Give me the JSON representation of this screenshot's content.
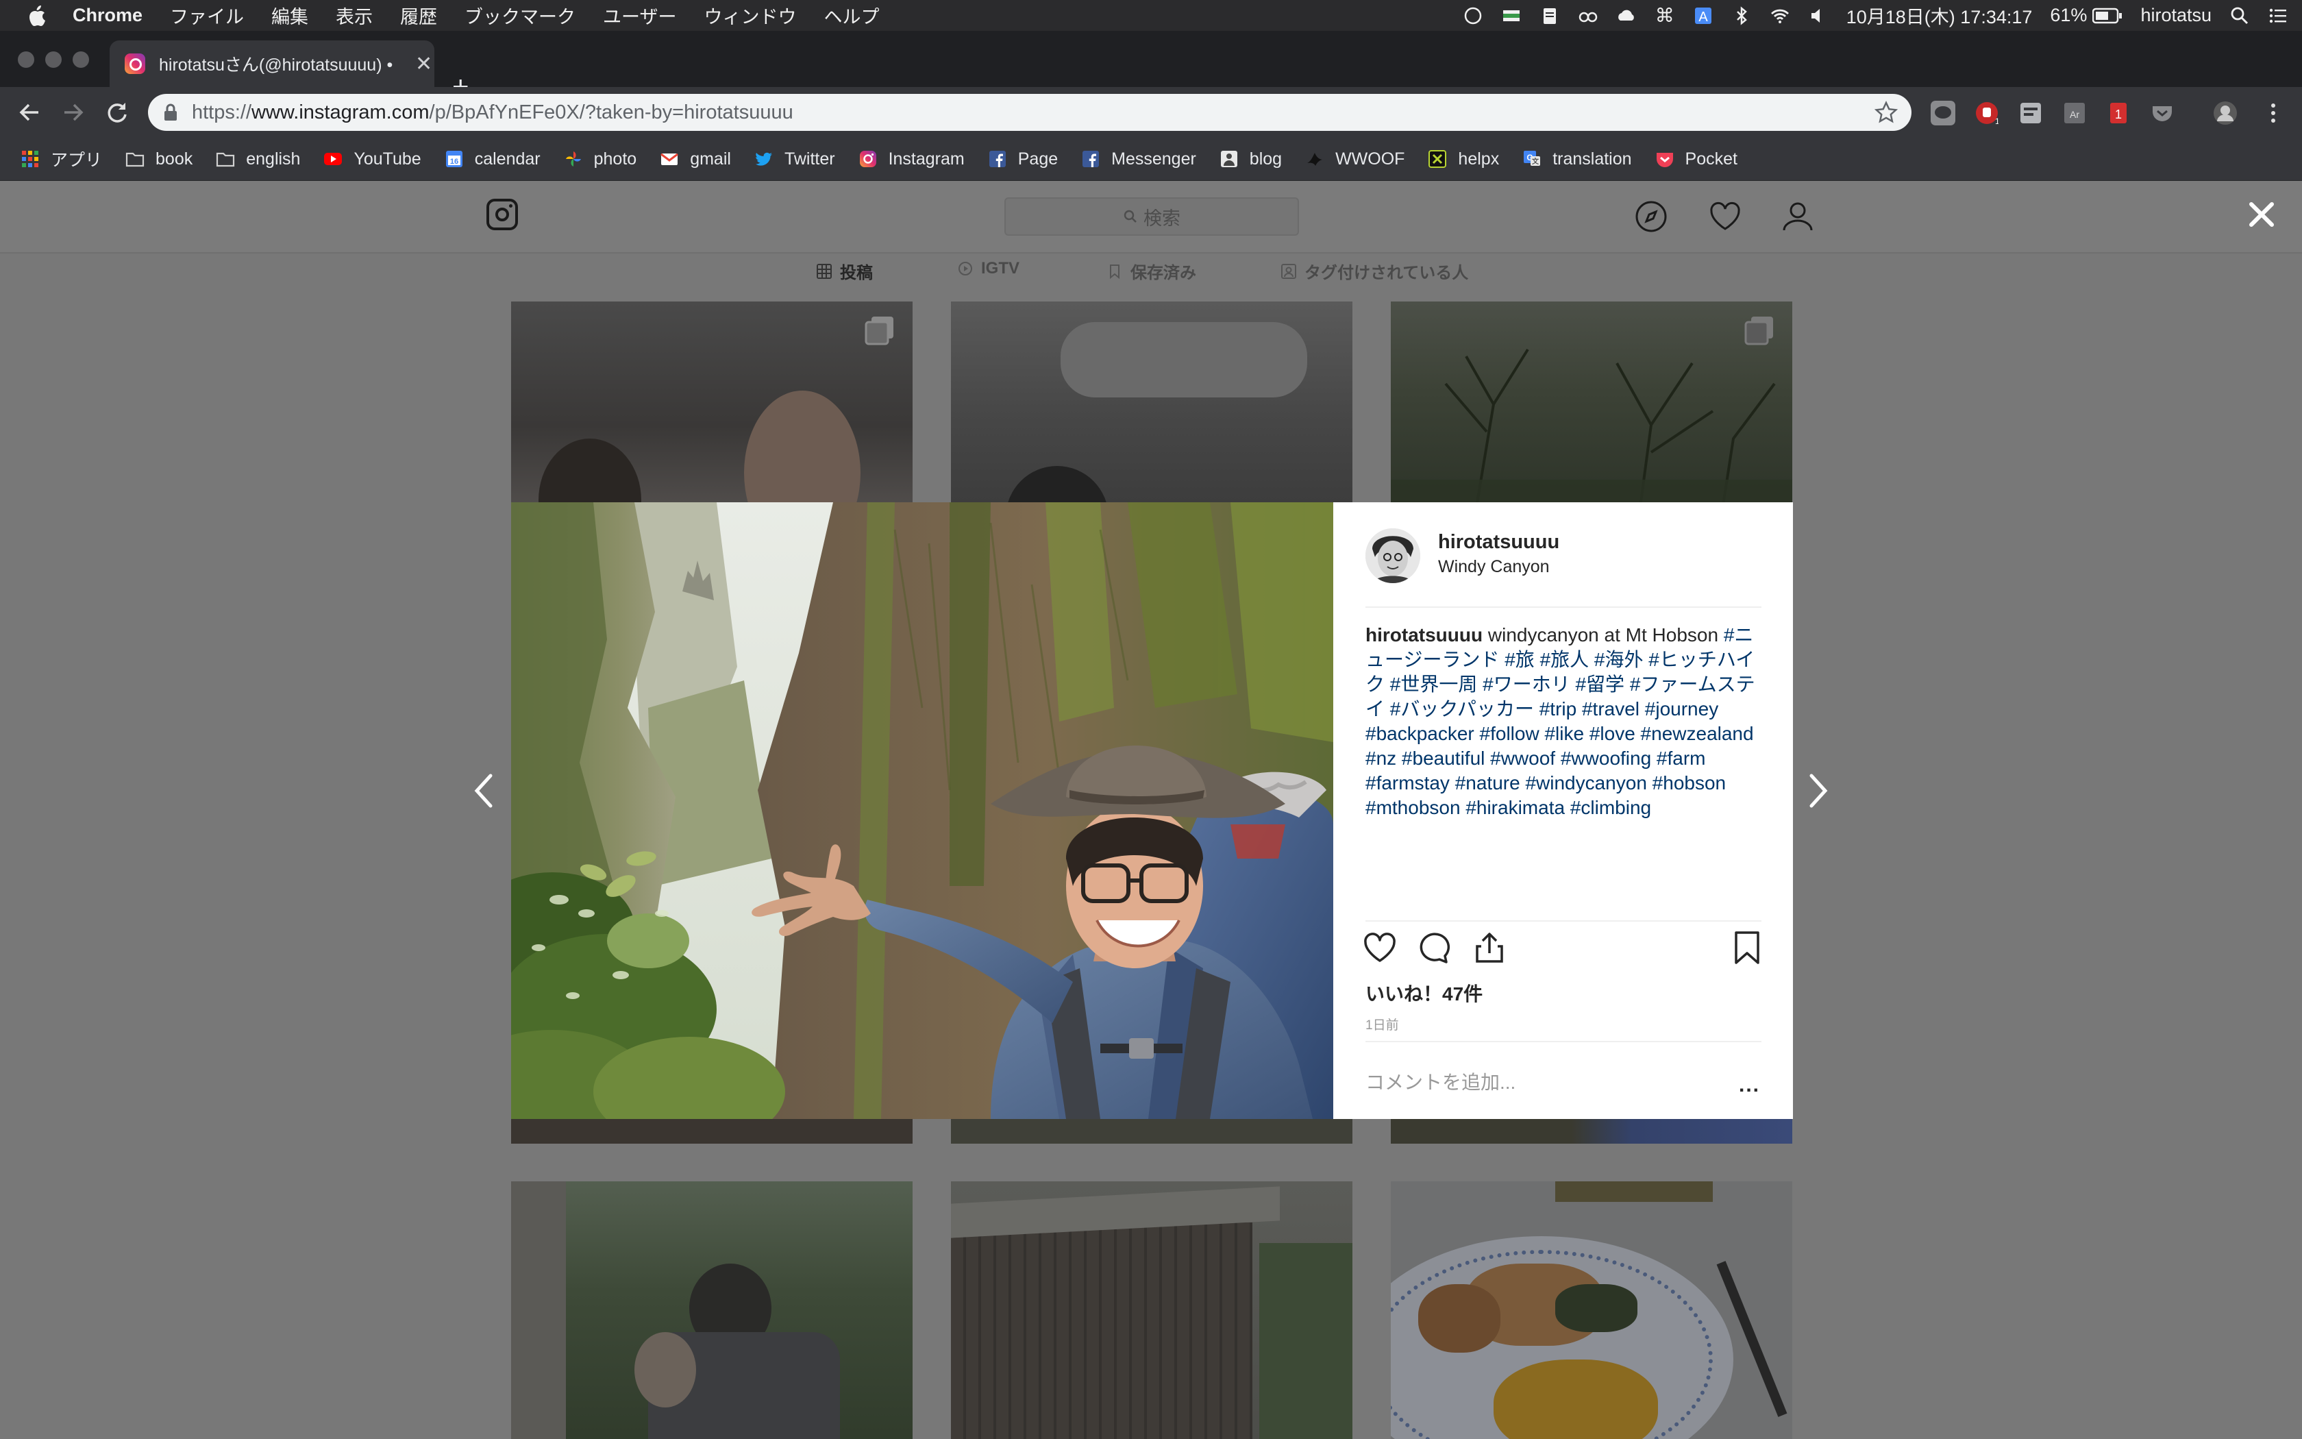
{
  "menubar": {
    "app_name": "Chrome",
    "menus": [
      "ファイル",
      "編集",
      "表示",
      "履歴",
      "ブックマーク",
      "ユーザー",
      "ウィンドウ",
      "ヘルプ"
    ],
    "datetime": "10月18日(木) 17:34:17",
    "battery": "61%",
    "user": "hirotatsu"
  },
  "tab": {
    "title": "hirotatsuさん(@hirotatsuuuu) •",
    "close": "✕"
  },
  "omnibox": {
    "scheme": "https://",
    "host": "www.instagram.com",
    "path": "/p/BpAfYnEFe0X/?taken-by=hirotatsuuuu"
  },
  "bookmarks": [
    {
      "label": "アプリ",
      "icon": "apps-grid-icon"
    },
    {
      "label": "book",
      "icon": "folder-icon"
    },
    {
      "label": "english",
      "icon": "folder-icon"
    },
    {
      "label": "YouTube",
      "icon": "youtube-icon"
    },
    {
      "label": "calendar",
      "icon": "calendar-icon"
    },
    {
      "label": "photo",
      "icon": "pinwheel-icon"
    },
    {
      "label": "gmail",
      "icon": "gmail-icon"
    },
    {
      "label": "Twitter",
      "icon": "twitter-icon"
    },
    {
      "label": "Instagram",
      "icon": "instagram-icon"
    },
    {
      "label": "Page",
      "icon": "facebook-icon"
    },
    {
      "label": "Messenger",
      "icon": "facebook-icon"
    },
    {
      "label": "blog",
      "icon": "blog-icon"
    },
    {
      "label": "WWOOF",
      "icon": "wwoof-icon"
    },
    {
      "label": "helpx",
      "icon": "helpx-icon"
    },
    {
      "label": "translation",
      "icon": "translate-icon"
    },
    {
      "label": "Pocket",
      "icon": "pocket-icon"
    }
  ],
  "instagram": {
    "search_placeholder": "検索",
    "profile_tabs": [
      "投稿",
      "IGTV",
      "保存済み",
      "タグ付けされている人"
    ]
  },
  "post": {
    "username": "hirotatsuuuu",
    "location": "Windy Canyon",
    "caption_user": "hirotatsuuuu",
    "caption_text": "windycanyon at Mt Hobson",
    "hashtags": "#ニュージーランド #旅 #旅人 #海外 #ヒッチハイク #世界一周 #ワーホリ #留学 #ファームステイ #バックパッカー #trip #travel #journey #backpacker #follow #like #love #newzealand #nz #beautiful #wwoof #wwoofing #farm #farmstay #nature #windycanyon #hobson #mthobson #hirakimata #climbing",
    "likes": "いいね！47件",
    "time": "1日前",
    "comment_placeholder": "コメントを追加...",
    "more": "..."
  }
}
